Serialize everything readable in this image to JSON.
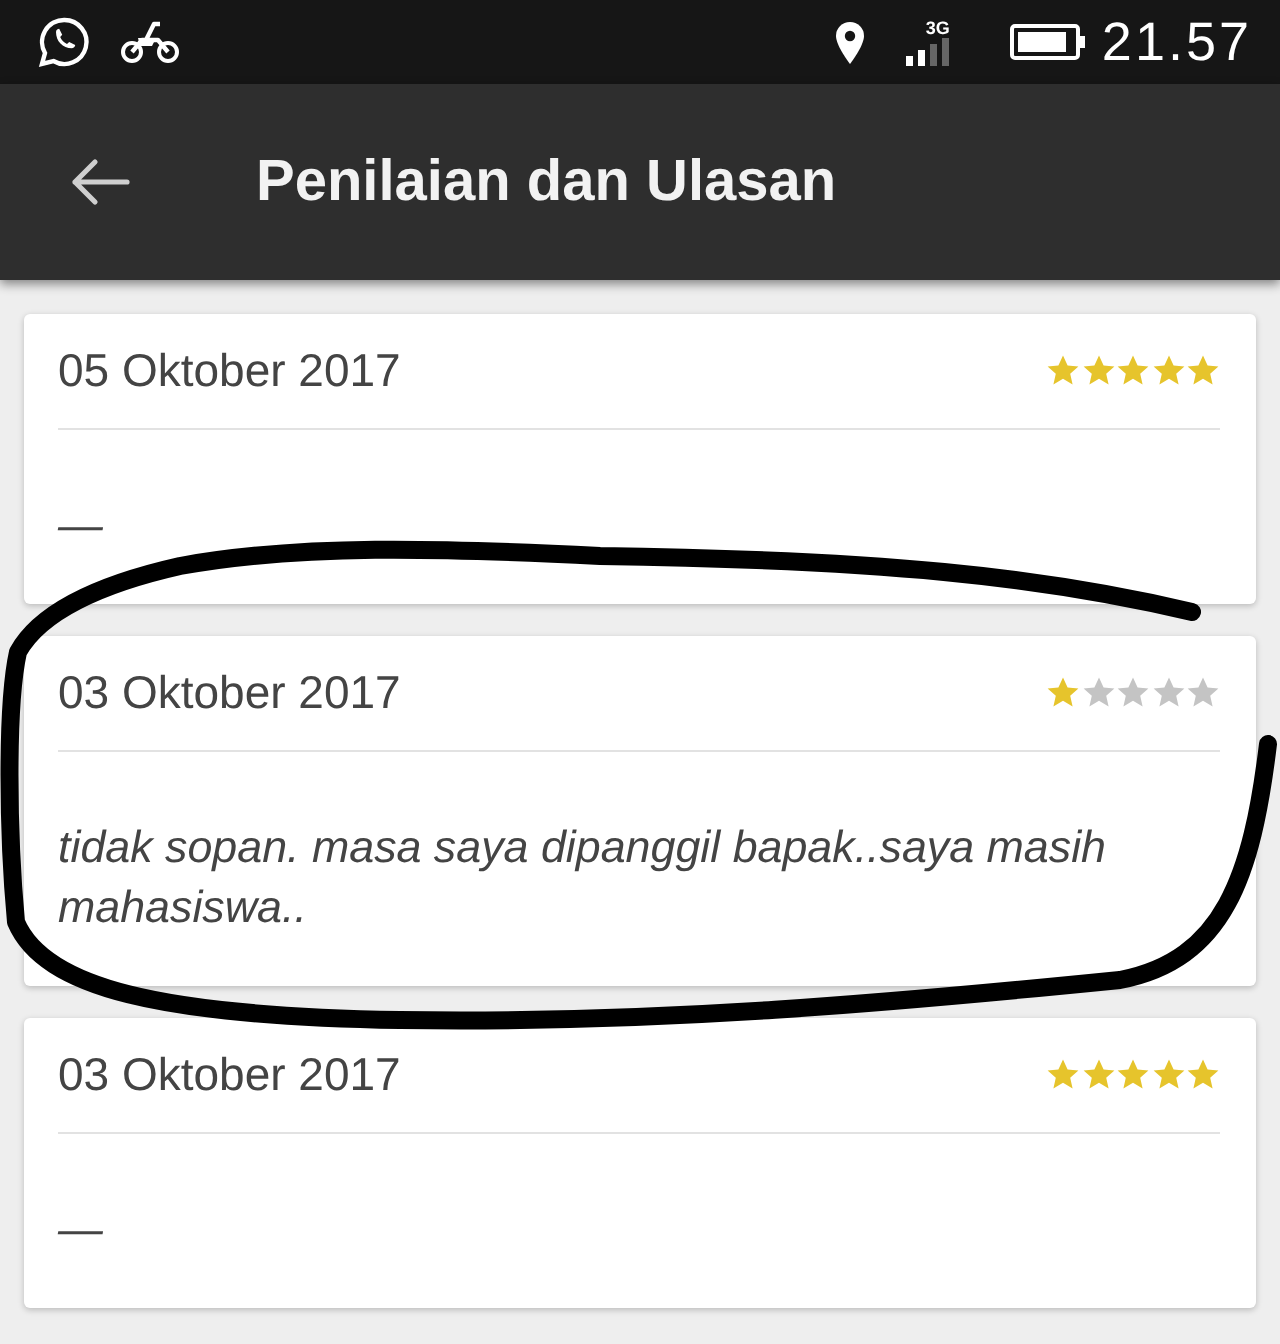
{
  "status_bar": {
    "network_type": "3G",
    "time": "21.57"
  },
  "app_bar": {
    "title": "Penilaian dan Ulasan"
  },
  "reviews": [
    {
      "date": "05 Oktober 2017",
      "stars": 5,
      "comment": "—",
      "circled": false
    },
    {
      "date": "03 Oktober 2017",
      "stars": 1,
      "comment": "tidak sopan. masa saya dipanggil bapak..saya masih mahasiswa..",
      "circled": true
    },
    {
      "date": "03 Oktober 2017",
      "stars": 5,
      "comment": "—",
      "circled": false
    }
  ]
}
